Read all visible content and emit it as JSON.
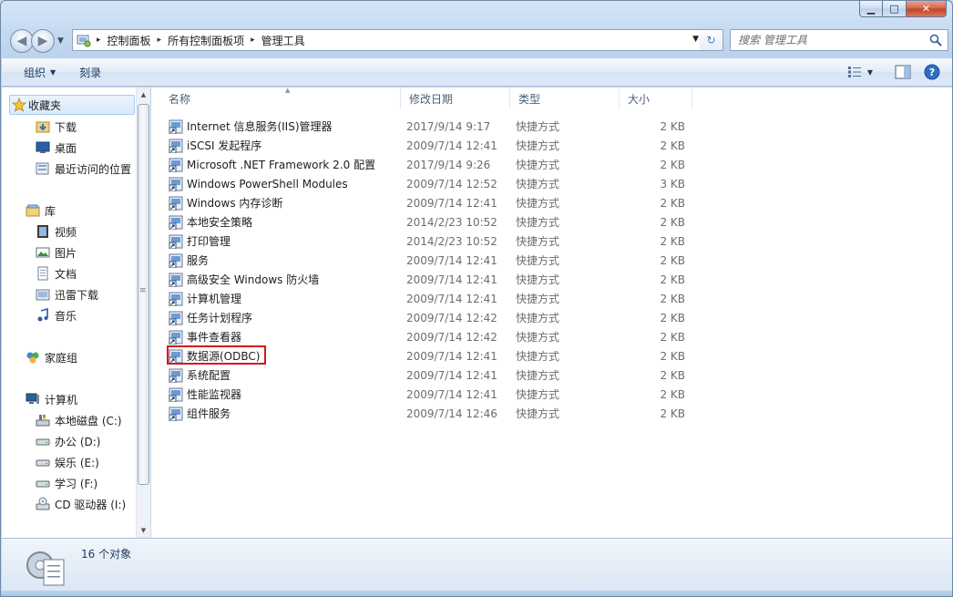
{
  "window": {
    "controls": {
      "minimize": "▁",
      "maximize": "□",
      "close": "✕"
    }
  },
  "nav": {
    "back": "◀",
    "forward": "▶",
    "dropdown": "▼"
  },
  "address": {
    "crumbs": [
      "控制面板",
      "所有控制面板项",
      "管理工具"
    ],
    "separator": "▸",
    "refresh": "↻",
    "dropdown": "▼"
  },
  "search": {
    "placeholder": "搜索 管理工具"
  },
  "commandbar": {
    "organize": "组织",
    "burn": "刻录",
    "caret": "▼"
  },
  "sidebar": {
    "favorites": {
      "label": "收藏夹",
      "items": [
        "下载",
        "桌面",
        "最近访问的位置"
      ]
    },
    "libraries": {
      "label": "库",
      "items": [
        "视频",
        "图片",
        "文档",
        "迅雷下载",
        "音乐"
      ]
    },
    "homegroup": {
      "label": "家庭组"
    },
    "computer": {
      "label": "计算机",
      "items": [
        "本地磁盘 (C:)",
        "办公 (D:)",
        "娱乐 (E:)",
        "学习 (F:)",
        "CD 驱动器 (I:)"
      ]
    }
  },
  "filelist": {
    "columns": {
      "name": "名称",
      "date": "修改日期",
      "type": "类型",
      "size": "大小"
    },
    "sort_arrow": "▲",
    "rows": [
      {
        "name": "Internet 信息服务(IIS)管理器",
        "date": "2017/9/14 9:17",
        "type": "快捷方式",
        "size": "2 KB"
      },
      {
        "name": "iSCSI 发起程序",
        "date": "2009/7/14 12:41",
        "type": "快捷方式",
        "size": "2 KB"
      },
      {
        "name": "Microsoft .NET Framework 2.0 配置",
        "date": "2017/9/14 9:26",
        "type": "快捷方式",
        "size": "2 KB"
      },
      {
        "name": "Windows PowerShell Modules",
        "date": "2009/7/14 12:52",
        "type": "快捷方式",
        "size": "3 KB"
      },
      {
        "name": "Windows 内存诊断",
        "date": "2009/7/14 12:41",
        "type": "快捷方式",
        "size": "2 KB"
      },
      {
        "name": "本地安全策略",
        "date": "2014/2/23 10:52",
        "type": "快捷方式",
        "size": "2 KB"
      },
      {
        "name": "打印管理",
        "date": "2014/2/23 10:52",
        "type": "快捷方式",
        "size": "2 KB"
      },
      {
        "name": "服务",
        "date": "2009/7/14 12:41",
        "type": "快捷方式",
        "size": "2 KB"
      },
      {
        "name": "高级安全 Windows 防火墙",
        "date": "2009/7/14 12:41",
        "type": "快捷方式",
        "size": "2 KB"
      },
      {
        "name": "计算机管理",
        "date": "2009/7/14 12:41",
        "type": "快捷方式",
        "size": "2 KB"
      },
      {
        "name": "任务计划程序",
        "date": "2009/7/14 12:42",
        "type": "快捷方式",
        "size": "2 KB"
      },
      {
        "name": "事件查看器",
        "date": "2009/7/14 12:42",
        "type": "快捷方式",
        "size": "2 KB"
      },
      {
        "name": "数据源(ODBC)",
        "date": "2009/7/14 12:41",
        "type": "快捷方式",
        "size": "2 KB"
      },
      {
        "name": "系统配置",
        "date": "2009/7/14 12:41",
        "type": "快捷方式",
        "size": "2 KB"
      },
      {
        "name": "性能监视器",
        "date": "2009/7/14 12:41",
        "type": "快捷方式",
        "size": "2 KB"
      },
      {
        "name": "组件服务",
        "date": "2009/7/14 12:46",
        "type": "快捷方式",
        "size": "2 KB"
      }
    ]
  },
  "status": {
    "count": "16 个对象"
  },
  "colors": {
    "highlight_box": "#d8141c",
    "selected_nav_bg": "#d9ebfc",
    "window_frame": "#c7dbf2"
  },
  "icons": {
    "favorites": "star-icon",
    "downloads": "folder-download-icon",
    "desktop": "desktop-icon",
    "recent": "recent-places-icon",
    "library": "library-icon",
    "video": "video-icon",
    "pictures": "pictures-icon",
    "documents": "documents-icon",
    "thunder": "folder-icon",
    "music": "music-icon",
    "homegroup": "homegroup-icon",
    "computer": "computer-icon",
    "drive": "drive-icon",
    "cdrom": "cd-drive-icon",
    "shortcut": "shortcut-icon"
  }
}
